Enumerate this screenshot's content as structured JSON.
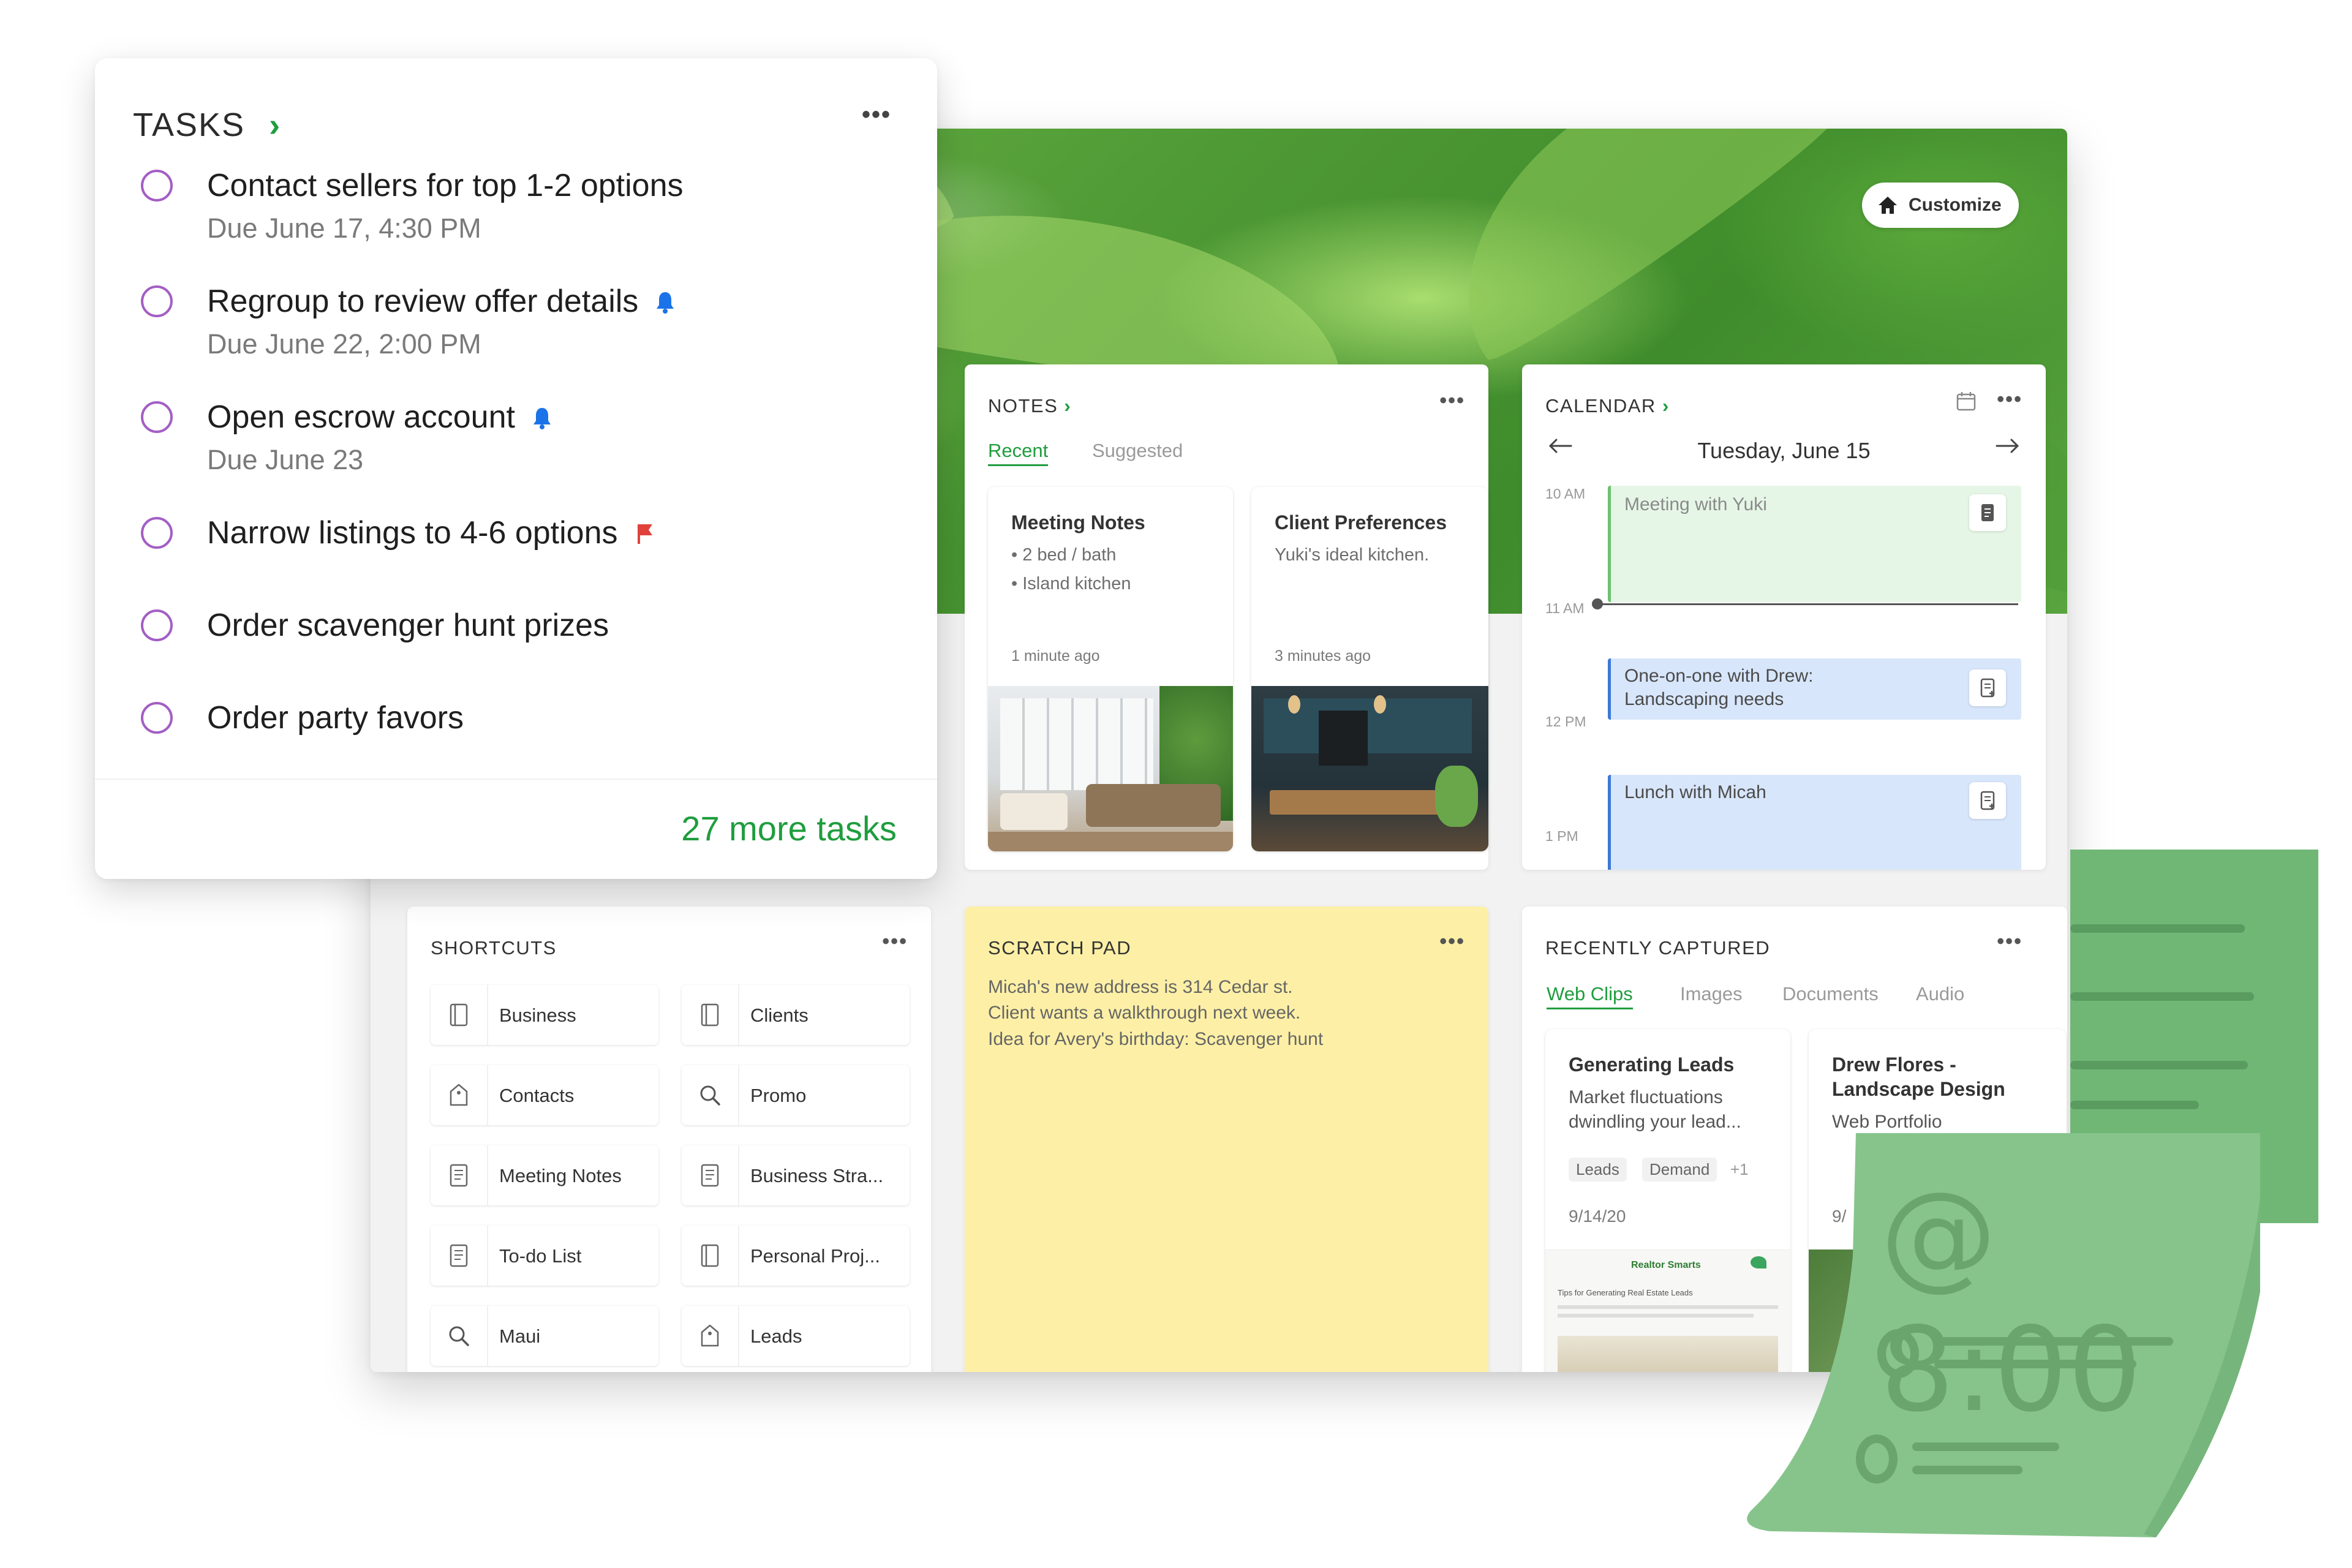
{
  "tasks": {
    "title": "TASKS",
    "chevron": "›",
    "menu": "•••",
    "items": [
      {
        "title": "Contact sellers for top 1-2 options",
        "due": "Due June 17, 4:30 PM",
        "indicator": ""
      },
      {
        "title": "Regroup to review offer details",
        "due": "Due June 22, 2:00 PM",
        "indicator": "bell-icon"
      },
      {
        "title": "Open escrow account",
        "due": "Due June 23",
        "indicator": "bell-icon"
      },
      {
        "title": "Narrow listings to 4-6 options",
        "due": "",
        "indicator": "flag-icon"
      },
      {
        "title": "Order scavenger hunt prizes",
        "due": "",
        "indicator": ""
      },
      {
        "title": "Order party favors",
        "due": "",
        "indicator": ""
      }
    ],
    "more_link": "27 more tasks",
    "colors": {
      "circle": "#a35ec4",
      "bell": "#1a73e8",
      "flag": "#e0423b",
      "link": "#1f9d3e"
    }
  },
  "hero": {
    "customize_label": "Customize"
  },
  "notes": {
    "title": "NOTES",
    "chevron": "›",
    "menu": "•••",
    "tabs": {
      "active": "Recent",
      "inactive": "Suggested"
    },
    "cards": [
      {
        "title": "Meeting Notes",
        "lines": [
          "• 2 bed / bath",
          "• Island kitchen"
        ],
        "time": "1 minute ago"
      },
      {
        "title": "Client Preferences",
        "lines": [
          "Yuki's ideal kitchen."
        ],
        "time": "3 minutes ago"
      }
    ]
  },
  "calendar": {
    "title": "CALENDAR",
    "chevron": "›",
    "menu": "•••",
    "date": "Tuesday, June 15",
    "times": [
      "10 AM",
      "11 AM",
      "12 PM",
      "1 PM"
    ],
    "events": [
      {
        "title": "Meeting with Yuki"
      },
      {
        "title_lines": [
          "One-on-one with Drew:",
          "Landscaping needs"
        ]
      },
      {
        "title": "Lunch with Micah"
      }
    ]
  },
  "shortcuts": {
    "title": "SHORTCUTS",
    "menu": "•••",
    "items": [
      {
        "label": "Business",
        "icon": "notebook-icon"
      },
      {
        "label": "Clients",
        "icon": "notebook-icon"
      },
      {
        "label": "Contacts",
        "icon": "tag-icon"
      },
      {
        "label": "Promo",
        "icon": "search-icon"
      },
      {
        "label": "Meeting Notes",
        "icon": "note-icon"
      },
      {
        "label": "Business Stra...",
        "icon": "note-icon"
      },
      {
        "label": "To-do List",
        "icon": "note-icon"
      },
      {
        "label": "Personal Proj...",
        "icon": "notebook-icon"
      },
      {
        "label": "Maui",
        "icon": "search-icon"
      },
      {
        "label": "Leads",
        "icon": "tag-icon"
      }
    ]
  },
  "scratch_pad": {
    "title": "SCRATCH PAD",
    "menu": "•••",
    "lines": [
      "Micah's new address is 314 Cedar st.",
      "Client wants a walkthrough next week.",
      "Idea for Avery's birthday: Scavenger hunt"
    ]
  },
  "recently_captured": {
    "title": "RECENTLY CAPTURED",
    "menu": "•••",
    "tabs": {
      "active": "Web Clips",
      "inactive": [
        "Images",
        "Documents",
        "Audio"
      ]
    },
    "cards": [
      {
        "title": "Generating Leads",
        "text_lines": [
          "Market fluctuations",
          "dwindling your lead..."
        ],
        "tags": [
          "Leads",
          "Demand",
          "+1"
        ],
        "date": "9/14/20",
        "thumb_title": "Realtor Smarts",
        "thumb_sub": "Tips for Generating Real Estate Leads"
      },
      {
        "title_lines": [
          "Drew Flores -",
          "Landscape Design"
        ],
        "text": "Web Portfolio",
        "date": "9/"
      }
    ]
  },
  "sticky": {
    "time": "@ 8:00"
  }
}
